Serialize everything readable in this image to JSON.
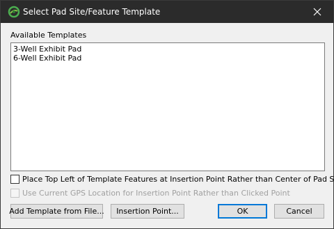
{
  "window": {
    "title": "Select Pad Site/Feature Template",
    "close_icon": "close-icon",
    "app_icon": "app-logo-icon"
  },
  "templates": {
    "label": "Available Templates",
    "items": [
      "3-Well Exhibit Pad",
      "6-Well Exhibit Pad"
    ]
  },
  "options": {
    "top_left": {
      "label": "Place Top Left of Template Features at Insertion Point Rather than Center of Pad Site",
      "checked": false,
      "enabled": true
    },
    "gps": {
      "label": "Use Current GPS Location for Insertion Point Rather than Clicked Point",
      "checked": false,
      "enabled": false
    }
  },
  "buttons": {
    "add_template": "Add Template from File...",
    "insertion_point": "Insertion Point...",
    "ok": "OK",
    "cancel": "Cancel"
  },
  "colors": {
    "titlebar": "#2b2b2b",
    "default_button_border": "#0078d7",
    "disabled_text": "#a0a0a0"
  }
}
